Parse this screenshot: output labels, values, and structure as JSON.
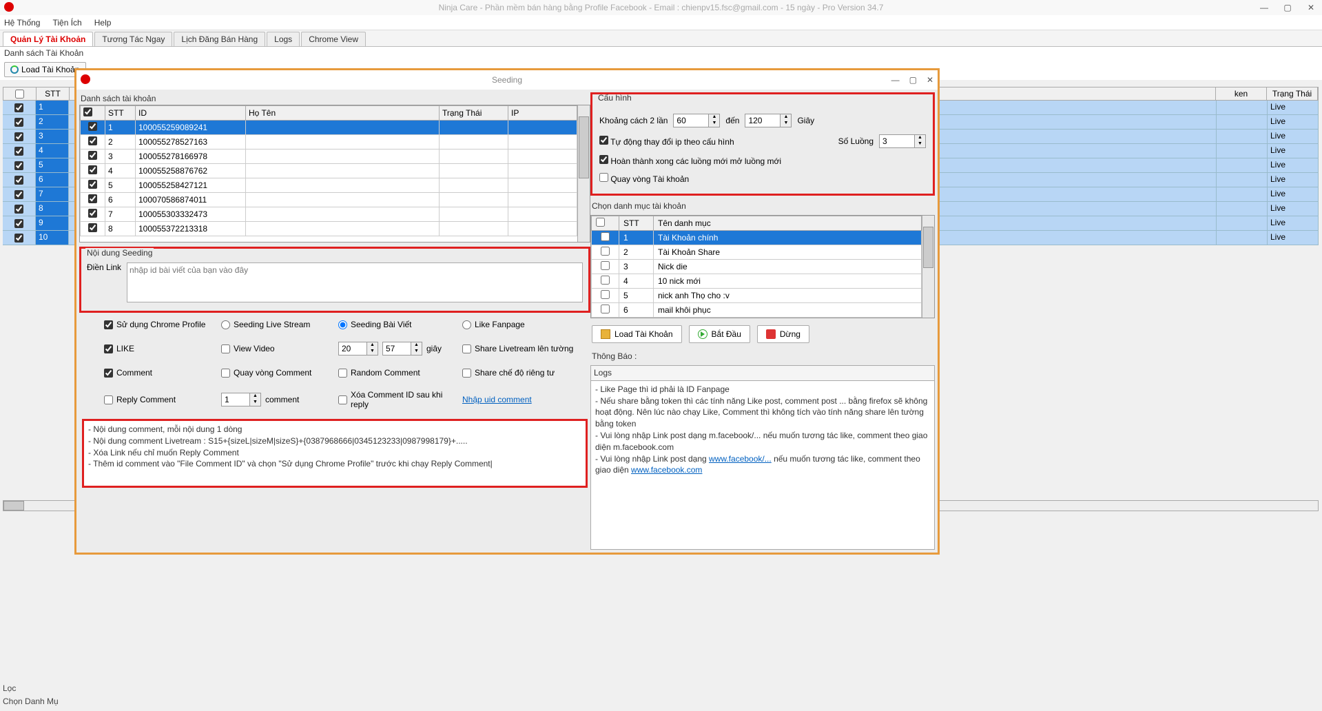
{
  "title": "Ninja Care - Phần mềm bán hàng bằng Profile Facebook - Email : chienpv15.fsc@gmail.com - 15 ngày - Pro Version 34.7",
  "menu": [
    "Hệ Thống",
    "Tiện Ích",
    "Help"
  ],
  "tabs": [
    "Quản Lý Tài Khoản",
    "Tương Tác Ngay",
    "Lịch Đăng Bán Hàng",
    "Logs",
    "Chrome View"
  ],
  "sublabel": "Danh sách Tài Khoản",
  "loadbtn": "Load Tài Khoản",
  "bg_grid": {
    "headers": {
      "stt": "STT",
      "token": "ken",
      "status": "Trạng Thái"
    },
    "rows": [
      {
        "stt": "1",
        "status": "Live"
      },
      {
        "stt": "2",
        "status": "Live"
      },
      {
        "stt": "3",
        "status": "Live"
      },
      {
        "stt": "4",
        "status": "Live"
      },
      {
        "stt": "5",
        "status": "Live"
      },
      {
        "stt": "6",
        "status": "Live"
      },
      {
        "stt": "7",
        "status": "Live"
      },
      {
        "stt": "8",
        "status": "Live"
      },
      {
        "stt": "9",
        "status": "Live"
      },
      {
        "stt": "10",
        "status": "Live"
      }
    ]
  },
  "bg_footer": {
    "loc": "Lọc",
    "chon": "Chọn Danh Mụ"
  },
  "modal": {
    "title": "Seeding",
    "accounts_label": "Danh sách tài khoản",
    "acct_headers": {
      "stt": "STT",
      "id": "ID",
      "name": "Họ Tên",
      "status": "Trạng Thái",
      "ip": "IP"
    },
    "accounts": [
      {
        "stt": "1",
        "id": "100055259089241"
      },
      {
        "stt": "2",
        "id": "100055278527163"
      },
      {
        "stt": "3",
        "id": "100055278166978"
      },
      {
        "stt": "4",
        "id": "100055258876762"
      },
      {
        "stt": "5",
        "id": "100055258427121"
      },
      {
        "stt": "6",
        "id": "100070586874011"
      },
      {
        "stt": "7",
        "id": "100055303332473"
      },
      {
        "stt": "8",
        "id": "100055372213318"
      }
    ],
    "seeding_content_label": "Nội dung Seeding",
    "link_label": "Điền Link",
    "link_placeholder": "nhập id bài viết của bạn vào đây",
    "opts": {
      "chrome_profile": "Sử dụng Chrome Profile",
      "live_stream": "Seeding Live Stream",
      "bai_viet": "Seeding Bài Viết",
      "like_fanpage": "Like Fanpage",
      "like": "LIKE",
      "view_video": "View Video",
      "spin1": "20",
      "spin2": "57",
      "giay": "giây",
      "share_live": "Share Livetream lên tường",
      "comment": "Comment",
      "loop_comment": "Quay vòng Comment",
      "random_comment": "Random Comment",
      "share_private": "Share chế độ riêng tư",
      "reply_comment": "Reply Comment",
      "reply_count": "1",
      "comment_word": "comment",
      "del_comment_id": "Xóa Comment ID sau khi reply",
      "import_uid": "Nhập uid comment"
    },
    "comment_lines": [
      "- Nội dung comment, mỗi nội dung 1 dòng",
      "- Nội dung comment Livetream : S15+{sizeL|sizeM|sizeS}+{0387968666|0345123233|0987998179}+.....",
      "- Xóa Link nếu chỉ muốn Reply Comment",
      "- Thêm id comment vào \"File Comment ID\" và chọn \"Sử dụng Chrome Profile\" trước khi chạy Reply Comment|"
    ],
    "config": {
      "label": "Cấu hình",
      "interval_label": "Khoảng cách 2 lần",
      "from": "60",
      "to_label": "đến",
      "to": "120",
      "unit": "Giây",
      "auto_ip": "Tự động thay đổi ip theo cấu hình",
      "threads_label": "Số Luồng",
      "threads": "3",
      "finish_threads": "Hoàn thành xong các luồng mới mở luồng mới",
      "loop_account": "Quay vòng Tài khoản"
    },
    "cat_label": "Chọn danh mục tài khoản",
    "cat_headers": {
      "stt": "STT",
      "name": "Tên danh mục"
    },
    "categories": [
      {
        "stt": "1",
        "name": "Tài Khoản chính"
      },
      {
        "stt": "2",
        "name": "Tài Khoản Share"
      },
      {
        "stt": "3",
        "name": "Nick die"
      },
      {
        "stt": "4",
        "name": "10 nick mới"
      },
      {
        "stt": "5",
        "name": "nick anh Thọ cho :v"
      },
      {
        "stt": "6",
        "name": "mail khôi phục"
      }
    ],
    "actions": {
      "load": "Load Tài Khoản",
      "start": "Bắt Đầu",
      "stop": "Dừng"
    },
    "thongbao": "Thông Báo :",
    "logs_label": "Logs",
    "logs_text1": "- Like Page thì id phải là ID Fanpage",
    "logs_text2": "- Nếu share bằng token thì các tính năng Like post, comment post ... bằng firefox sẽ không hoạt động. Nên lúc nào chạy Like, Comment thì không tích vào tính năng share lên tường bằng token",
    "logs_text3a": "- Vui lòng nhập Link post dạng m.facebook/... nếu muốn tương tác like, comment theo giao diện m.facebook.com",
    "logs_text4a": "- Vui lòng nhập Link post dạng ",
    "logs_link1": "www.facebook/...",
    "logs_text4b": " nếu muốn tương tác like, comment theo giao diện ",
    "logs_link2": "www.facebook.com"
  }
}
